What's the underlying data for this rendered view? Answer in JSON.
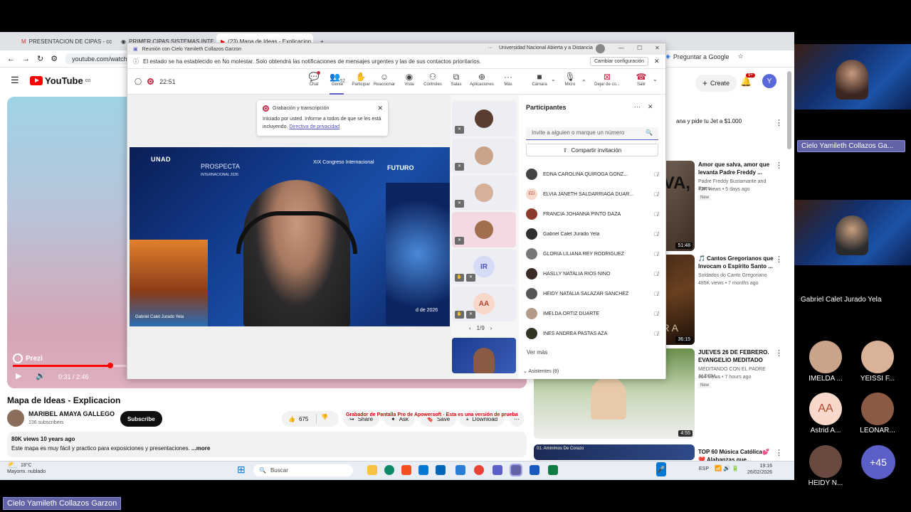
{
  "browser": {
    "tabs": [
      "PRESENTACION DE CIPAS - cc",
      "PRIMER CIPAS SISTEMAS INTE",
      "(23) Mapa de Ideas - Explicacion"
    ],
    "url": "youtube.com/watch?v=c",
    "ask_google": "Preguntar a Google"
  },
  "youtube": {
    "logo": "YouTube",
    "logo_suffix": "CO",
    "create": "Create",
    "notif_count": "9+",
    "avatar_letter": "Y",
    "player": {
      "overlay": "Prezi",
      "time": "0:31 / 2:46",
      "progress": 0.19
    },
    "video_title": "Mapa de Ideas - Explicacion",
    "channel": "MARIBEL AMAYA GALLEGO",
    "subscribers": "136 subscribers",
    "subscribe": "Subscribe",
    "likes": "675",
    "share": "Share",
    "ask": "Ask",
    "save": "Save",
    "download": "Download",
    "desc_meta": "80K views  10 years ago",
    "desc_text": "Este mapa es muy fácil y practico para exposiciones y presentaciones.",
    "desc_more": "...more",
    "ad_text": "ana y pide tu Jet a $1.000",
    "sidebar": [
      {
        "title": "Amor que salva, amor que levanta    Padre Freddy ...",
        "channel": "Padre Freddy Bustamante and Parro...",
        "meta": "42K views • 5 days ago",
        "badge": "New",
        "duration": "51:48",
        "thumb_text": "ALVA,"
      },
      {
        "title": "🎵 Cantos Gregorianos que Invocam o Espírito Santo ...",
        "channel": "Soldados do Canto Gregoriano",
        "meta": "485K views • 7 months ago",
        "badge": "",
        "duration": "36:15",
        "thumb_text": "RA"
      },
      {
        "title": "JUEVES 26 DE FEBRERO. EVANGELIO MEDITADO",
        "channel": "MEDITANDO CON EL PADRE ALDEM...",
        "meta": "104 views • 7 hours ago",
        "badge": "New",
        "duration": "4:55",
        "thumb_text": ""
      },
      {
        "title": "TOP 60 Música Católica💕 ❤️ Alabanzas que...",
        "channel": "",
        "meta": "",
        "badge": "",
        "duration": "",
        "thumb_text": "01. Aminimos De Corazo"
      }
    ]
  },
  "taskbar": {
    "temp": "18°C",
    "weather": "Mayorm. nublado",
    "search": "Buscar",
    "lang": "ESP",
    "time": "19:16",
    "date": "26/02/2026"
  },
  "teams": {
    "title": "Reunión con Cielo Yamileth Collazos Garzon",
    "org": "Universidad Nacional Abierta y a Distancia",
    "dnd_text": "El estado se ha establecido en No molestar. Solo obtendrá las notificaciones de mensajes urgentes y las de sus contactos prioritarios.",
    "dnd_button": "Cambiar configuración",
    "timer": "22:51",
    "toolbar": [
      {
        "label": "Chat",
        "icon": "chat-icon"
      },
      {
        "label": "Gente",
        "icon": "people-icon",
        "count": "52"
      },
      {
        "label": "Participar",
        "icon": "hand-icon"
      },
      {
        "label": "Reaccionar",
        "icon": "smile-icon"
      },
      {
        "label": "Vista",
        "icon": "view-icon"
      },
      {
        "label": "Controles",
        "icon": "controls-icon"
      },
      {
        "label": "Salas",
        "icon": "rooms-icon"
      },
      {
        "label": "Aplicaciones",
        "icon": "apps-icon"
      },
      {
        "label": "Más",
        "icon": "more-icon"
      },
      {
        "label": "Cámara",
        "icon": "camera-icon"
      },
      {
        "label": "Micro",
        "icon": "mic-icon"
      },
      {
        "label": "Dejar de co...",
        "icon": "stop-share-icon"
      },
      {
        "label": "Salir",
        "icon": "leave-icon"
      }
    ],
    "toast": {
      "title": "Grabación y transcripción",
      "body": "Iniciado por usted. Informe a todos de que se les está incluyendo.",
      "link": "Directiva de privacidad"
    },
    "stage": {
      "logo1": "UNAD",
      "logo2": "PROSPECTA",
      "logo2_sub": "INTERNACIONAL 2026",
      "logo3": "XIX Congreso Internacional",
      "logo4": "FUTURO",
      "speaker": "Gabriel Calet Jurado Yela",
      "date": "d de 2026"
    },
    "film_initials": [
      "IR",
      "AA"
    ],
    "pager": "1/9",
    "panel_title": "Participantes",
    "invite_placeholder": "Invite a alguien o marque un número",
    "share_invite": "Compartir invitación",
    "participants": [
      {
        "name": "EDNA CAROLINA QUIROGA GONZ...",
        "initials": ""
      },
      {
        "name": "ELVIA JANETH SALDARRIAGA DUAR...",
        "initials": "ED"
      },
      {
        "name": "FRANCIA JOHANNA PINTO DAZA",
        "initials": ""
      },
      {
        "name": "Gabriel Calet Jurado Yela",
        "initials": ""
      },
      {
        "name": "GLORIA LILIANA REY RODRIGUEZ",
        "initials": ""
      },
      {
        "name": "HASLLY NATALIA RIOS NINO",
        "initials": ""
      },
      {
        "name": "HEIDY NATALIA SALAZAR SANCHEZ",
        "initials": ""
      },
      {
        "name": "IMELDA ORTIZ DUARTE",
        "initials": ""
      },
      {
        "name": "INES ANDREA PASTAS AZA",
        "initials": ""
      }
    ],
    "see_more": "Ver más",
    "attendees": "Asistentes (8)"
  },
  "recorder_watermark": "Grabador de Pantalla Pro de Apowersoft - Esta es una versión de prueba",
  "gallery": {
    "presenter": "Cielo Yamileth Collazos Ga...",
    "second": "Gabriel Calet Jurado Yela",
    "small": [
      {
        "name": "IMELDA ...",
        "initials": ""
      },
      {
        "name": "YEISSI F...",
        "initials": ""
      },
      {
        "name": "Astrid A...",
        "initials": "AA"
      },
      {
        "name": "LEONAR...",
        "initials": ""
      },
      {
        "name": "HEIDY N...",
        "initials": ""
      }
    ],
    "more": "+45"
  },
  "bottom_label": "Cielo Yamileth Collazos Garzon",
  "colors": {
    "teams_accent": "#5b5fc7",
    "youtube_red": "#ff0000",
    "record_red": "#c4314b"
  }
}
